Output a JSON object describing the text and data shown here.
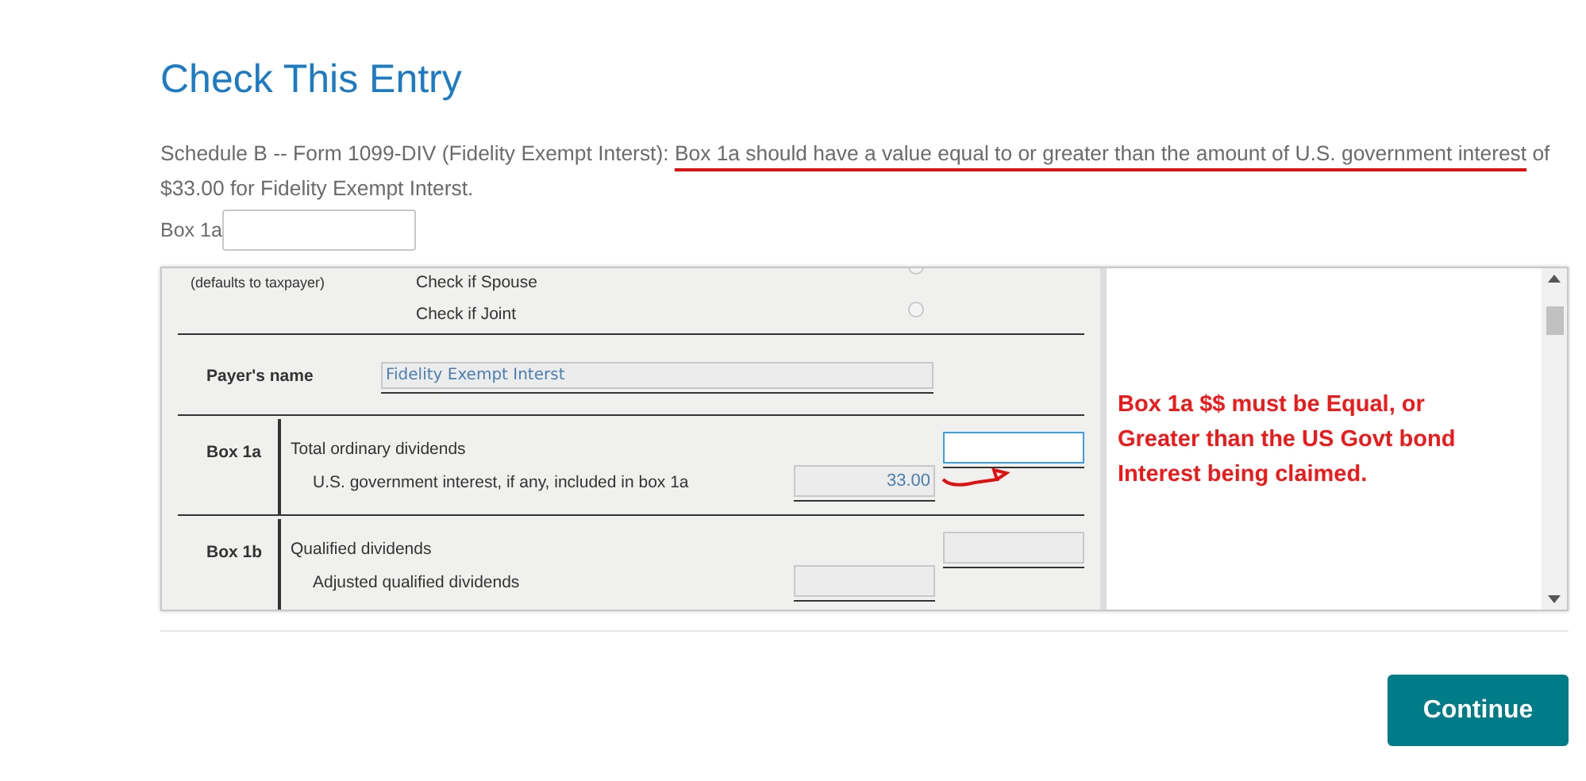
{
  "title": "Check This Entry",
  "message": {
    "prefix": "Schedule B -- Form 1099-DIV (Fidelity Exempt Interst): ",
    "highlighted": "Box 1a should have a value equal to or greater than the amount of U.S. government interest",
    "suffix": " of $33.00 for Fidelity Exempt Interst."
  },
  "answer_field": {
    "label": "Box 1a"
  },
  "form": {
    "owner_note": "(defaults to taxpayer)",
    "owner_options": [
      {
        "label": "Check if Spouse",
        "checked": false
      },
      {
        "label": "Check if Joint",
        "checked": false
      }
    ],
    "payer": {
      "label": "Payer's name",
      "value": "Fidelity Exempt Interst"
    },
    "boxes": [
      {
        "box": "Box 1a",
        "lines": [
          {
            "kind": "main",
            "label": "Total ordinary dividends",
            "focused": true
          },
          {
            "kind": "sub",
            "label": "U.S. government interest, if any, included in box 1a",
            "value": "33.00",
            "focused": false
          }
        ]
      },
      {
        "box": "Box 1b",
        "lines": [
          {
            "kind": "main",
            "label": "Qualified dividends",
            "focused": false
          },
          {
            "kind": "sub",
            "label": "Adjusted qualified dividends",
            "focused": false
          }
        ]
      }
    ]
  },
  "annotation": {
    "note": "Box 1a $$ must be Equal, or Greater than the US Govt bond Interest being claimed."
  },
  "continue_button": "Continue"
}
